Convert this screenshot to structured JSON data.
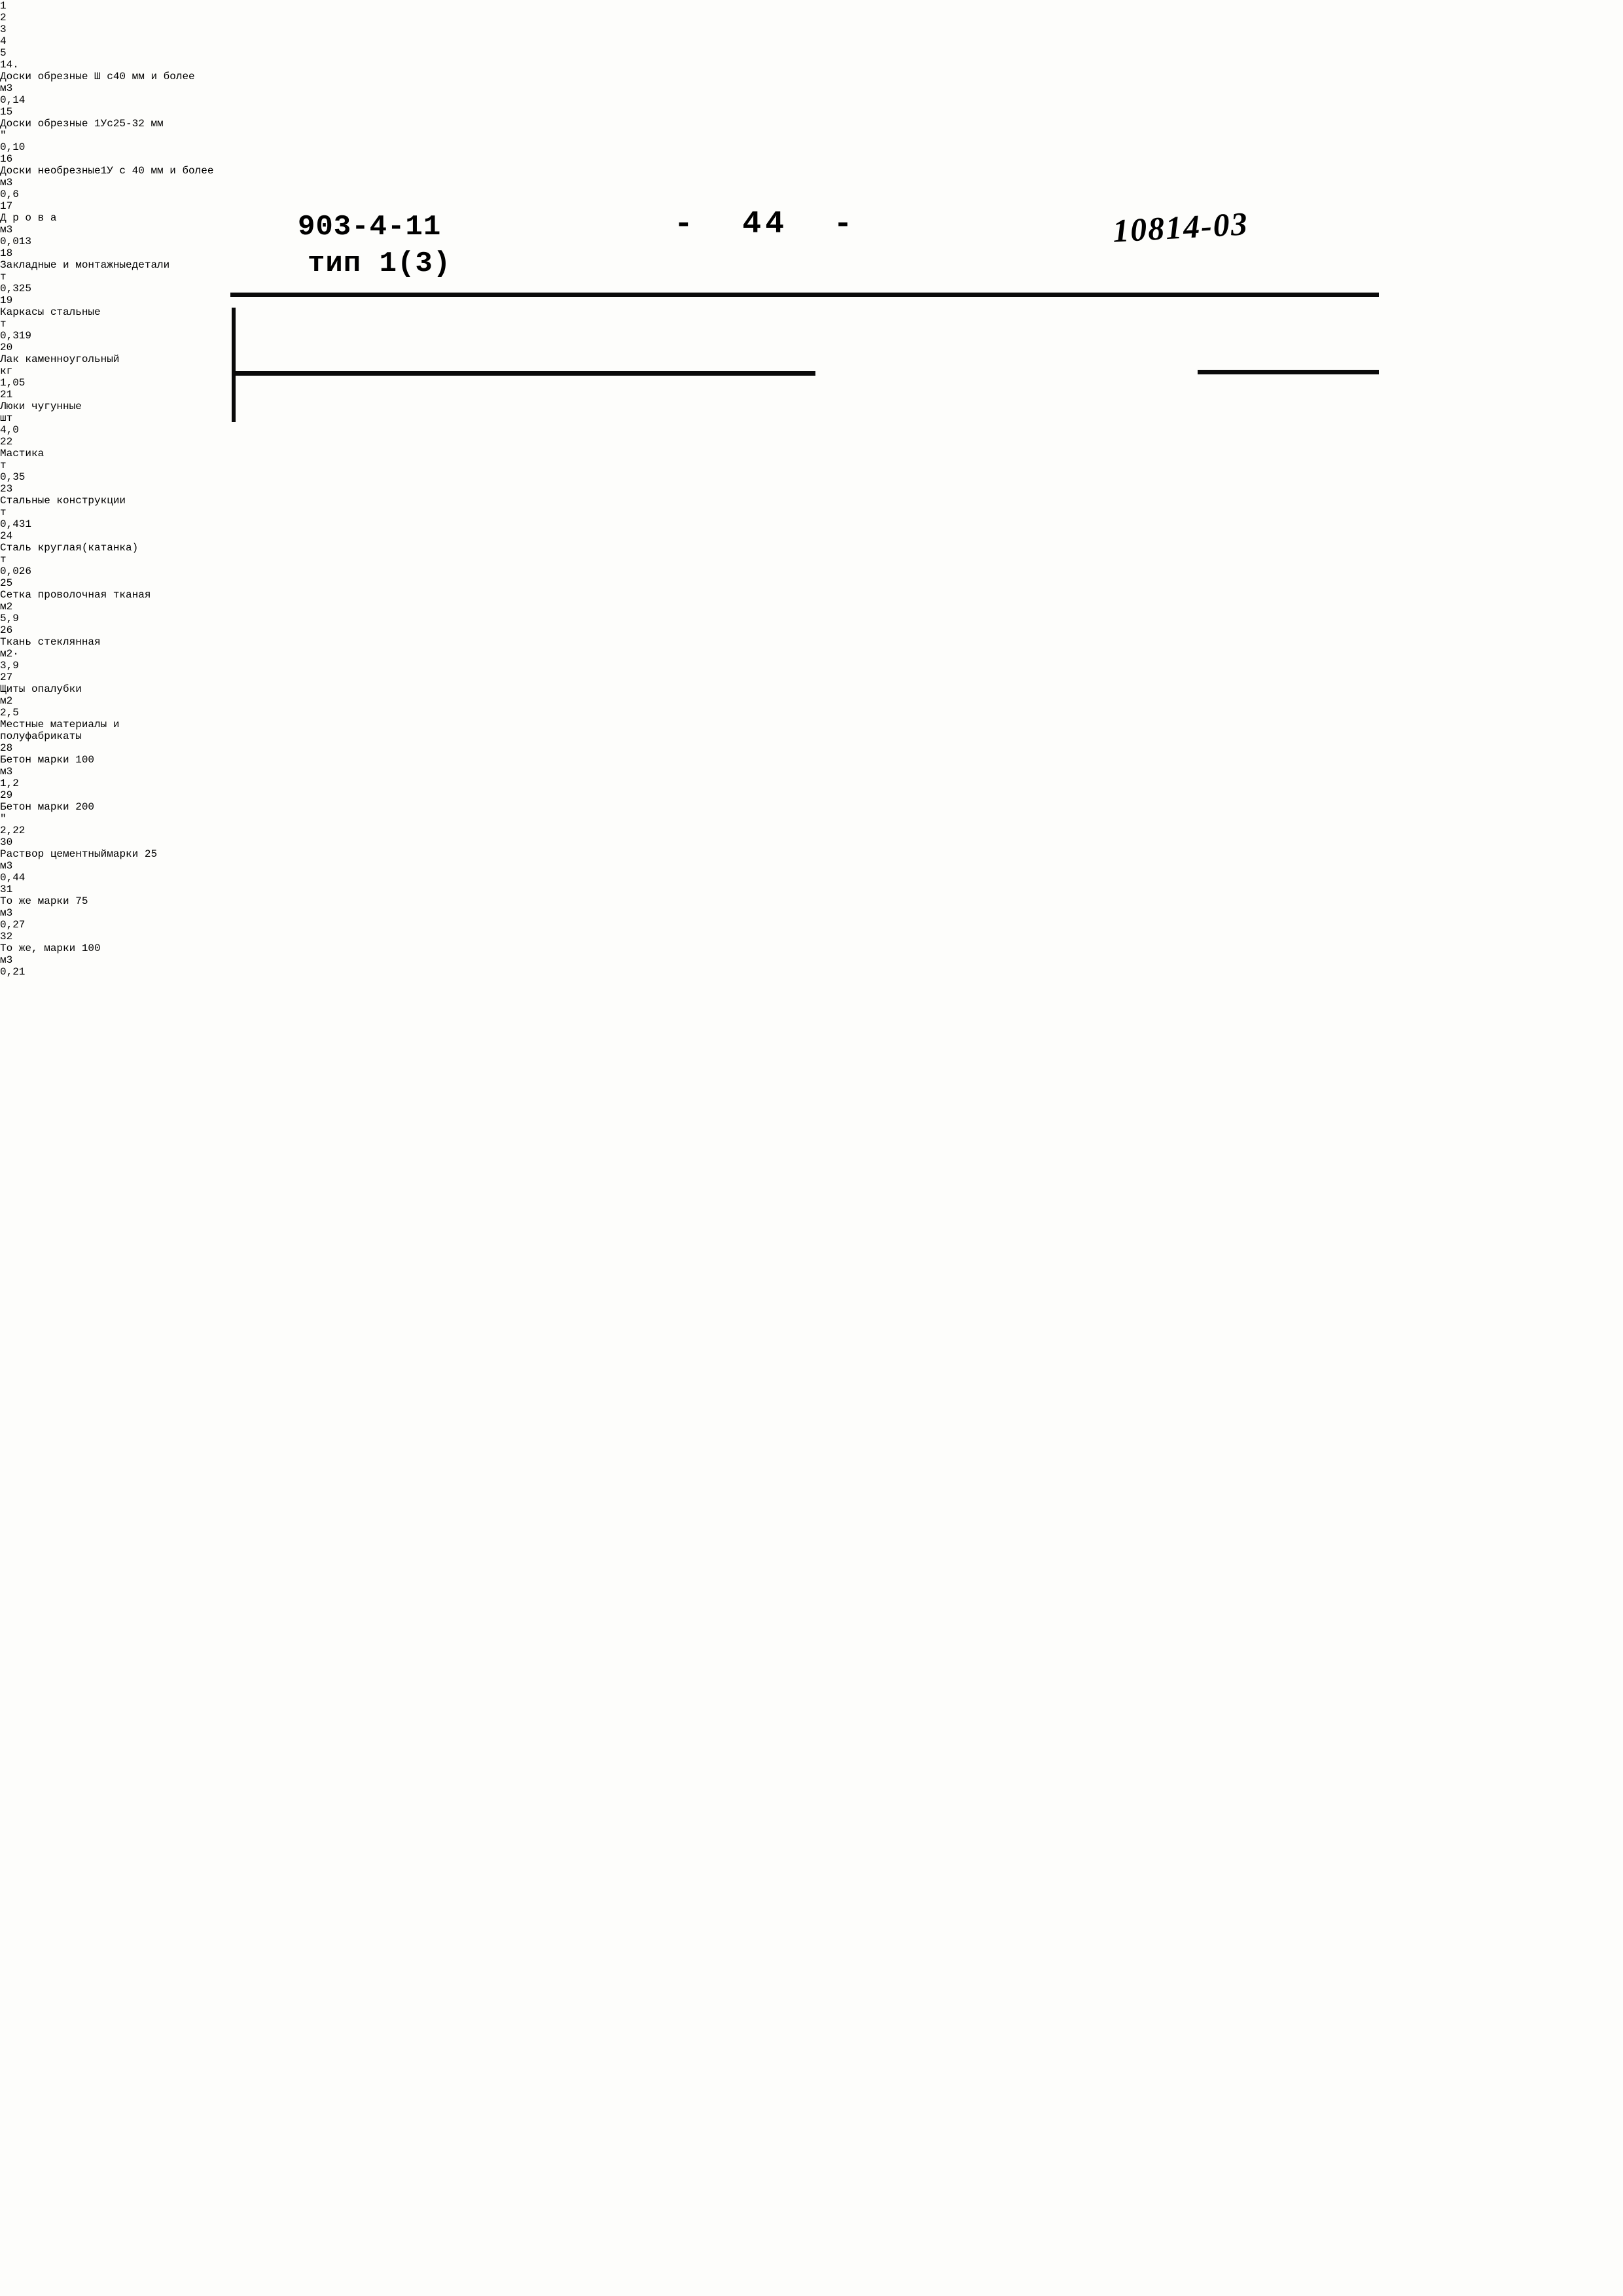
{
  "header": {
    "doc_code": "903-4-11",
    "doc_type": "тип 1(3)",
    "page_marker": "-  44  -",
    "archive_stamp": "10814-03"
  },
  "table": {
    "column_headers": [
      "1",
      "2",
      "3",
      "4",
      "5"
    ],
    "rows": [
      {
        "num": "14.",
        "name_l1": "Доски   обрезные   Ш с",
        "name_l2": "40 мм   и  более",
        "unit": "м3",
        "qty": "0,14",
        "remark": ""
      },
      {
        "num": "15",
        "name_l1": "Доски обрезные 1Ус",
        "name_l2": "25-32  мм",
        "unit": "\"",
        "qty": "0,10",
        "remark": ""
      },
      {
        "num": "16",
        "name_l1": "Доски  необрезные",
        "name_l2": "1У с 40 мм и  более",
        "unit": "м3",
        "qty": "0,6",
        "remark": ""
      },
      {
        "num": "17",
        "name_l1": "Д р о в а",
        "name_l2": "",
        "unit": "м3",
        "qty": "0,013",
        "remark": ""
      },
      {
        "num": "18",
        "name_l1": "Закладные и монтажные",
        "name_l2": "детали",
        "unit": "т",
        "qty": "0,325",
        "remark": ""
      },
      {
        "num": "19",
        "name_l1": "Каркасы  стальные",
        "name_l2": "",
        "unit": "т",
        "qty": "0,319",
        "remark": ""
      },
      {
        "num": "20",
        "name_l1": "Лак  каменноугольный",
        "name_l2": "",
        "unit": "кг",
        "qty": "1,05",
        "remark": ""
      },
      {
        "num": "21",
        "name_l1": "Люки  чугунные",
        "name_l2": "",
        "unit": "шт",
        "qty": "4,0",
        "remark": ""
      },
      {
        "num": "22",
        "name_l1": "Мастика",
        "name_l2": "",
        "unit": "т",
        "qty": "0,35",
        "remark": ""
      },
      {
        "num": "23",
        "name_l1": "Стальные  конструкции",
        "name_l2": "",
        "unit": "т",
        "qty": "0,431",
        "remark": ""
      },
      {
        "num": "24",
        "name_l1": "Сталь круглая(катанка)",
        "name_l2": "",
        "unit": "т",
        "qty": "0,026",
        "remark": ""
      },
      {
        "num": "25",
        "name_l1": "Сетка проволочная тканая",
        "name_l2": "",
        "unit": "м2",
        "qty": "5,9",
        "remark": ""
      },
      {
        "num": "26",
        "name_l1": "Ткань  стеклянная",
        "name_l2": "",
        "unit": "м2·",
        "qty": "3,9",
        "remark": ""
      },
      {
        "num": "27",
        "name_l1": "Щиты  опалубки",
        "name_l2": "",
        "unit": "м2",
        "qty": "2,5",
        "remark": ""
      },
      {
        "num": "28",
        "name_l1": "Бетон  марки  100",
        "name_l2": "",
        "unit": "м3",
        "qty": "1,2",
        "remark": ""
      },
      {
        "num": "29",
        "name_l1": "Бетон  марки  200",
        "name_l2": "",
        "unit": "\"",
        "qty": "2,22",
        "remark": ""
      },
      {
        "num": "30",
        "name_l1": "Раствор цементный",
        "name_l2": "марки  25",
        "unit": "м3",
        "qty": "0,44",
        "remark": ""
      },
      {
        "num": "31",
        "name_l1": "То же марки  75",
        "name_l2": "",
        "unit": "м3",
        "qty": "0,27",
        "remark": ""
      },
      {
        "num": "32",
        "name_l1": "То же,  марки 100",
        "name_l2": "",
        "unit": "м3",
        "qty": "0,21",
        "remark": ""
      }
    ],
    "section_heading": {
      "line1": "Местные  материалы  и",
      "line2": "полуфабрикаты"
    }
  }
}
